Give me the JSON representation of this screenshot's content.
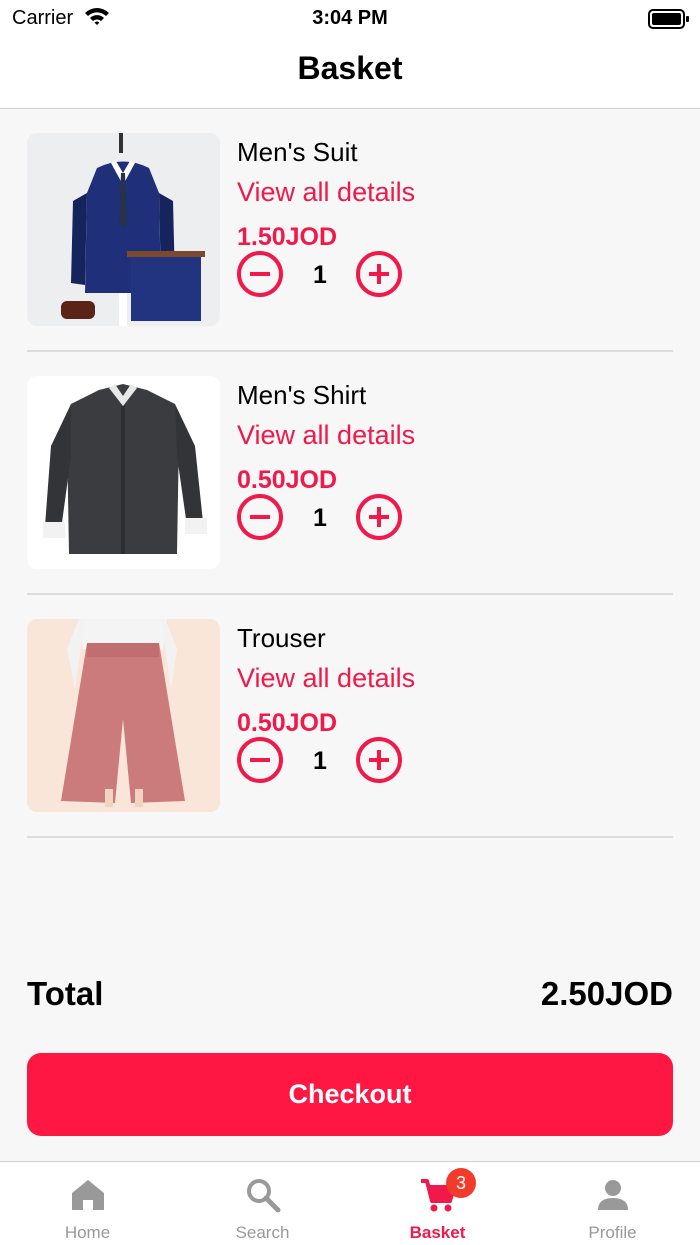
{
  "status_bar": {
    "carrier": "Carrier",
    "time": "3:04 PM"
  },
  "header": {
    "title": "Basket"
  },
  "items": [
    {
      "name": "Men's Suit",
      "details_link": "View all details",
      "price": "1.50JOD",
      "quantity": "1",
      "image": "mens-suit-photo"
    },
    {
      "name": "Men's Shirt",
      "details_link": "View all details",
      "price": "0.50JOD",
      "quantity": "1",
      "image": "mens-shirt-photo"
    },
    {
      "name": "Trouser",
      "details_link": "View all details",
      "price": "0.50JOD",
      "quantity": "1",
      "image": "trouser-photo"
    }
  ],
  "summary": {
    "total_label": "Total",
    "total_value": "2.50JOD"
  },
  "checkout": {
    "label": "Checkout"
  },
  "tab_bar": {
    "active_color": "#f0194a",
    "inactive_color": "#999999",
    "tabs": [
      {
        "label": "Home",
        "icon": "home-icon"
      },
      {
        "label": "Search",
        "icon": "search-icon"
      },
      {
        "label": "Basket",
        "icon": "cart-icon",
        "badge": "3"
      },
      {
        "label": "Profile",
        "icon": "person-icon"
      }
    ]
  },
  "colors": {
    "accent": "#f0194a",
    "checkout_button": "#ff1744",
    "background": "#f7f7f7",
    "badge": "#f23b2b"
  }
}
